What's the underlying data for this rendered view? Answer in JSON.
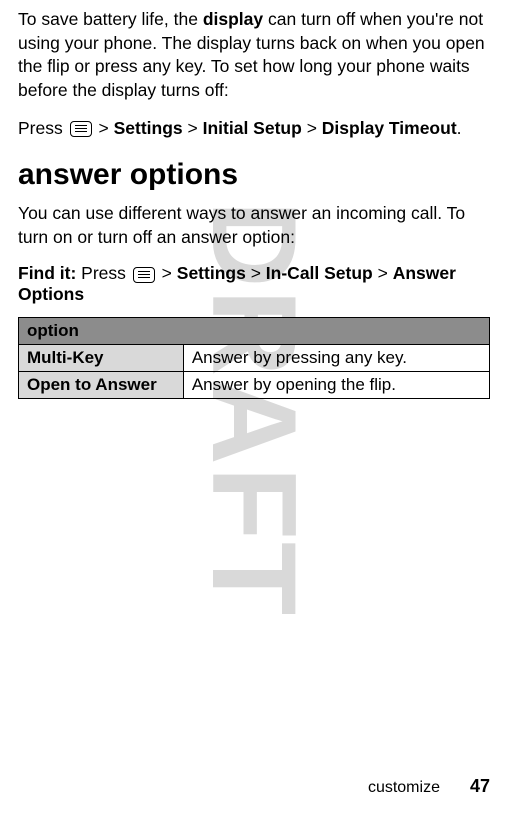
{
  "watermark": "DRAFT",
  "intro_part1": "To save battery life, the ",
  "intro_bold": "display",
  "intro_part2": " can turn off when you're not using your phone. The display turns back on when you open the flip or press any key. To set how long your phone waits before the display turns off:",
  "press_label": "Press ",
  "gt": ">",
  "path1_settings": "Settings",
  "path1_initial": "Initial Setup",
  "path1_display": "Display Timeout",
  "period": ".",
  "heading": "answer options",
  "para2": "You can use different ways to answer an incoming call. To turn on or turn off an answer option:",
  "find_it_label": "Find it:",
  "find_it_press": " Press ",
  "path2_settings": "Settings",
  "path2_incall": "In-Call Setup",
  "path2_answer": "Answer Options",
  "table_header": "option",
  "row1_opt": "Multi-Key",
  "row1_desc": "Answer by pressing any key.",
  "row2_opt": "Open to Answer",
  "row2_desc": "Answer by opening the flip.",
  "footer_section": "customize",
  "footer_page": "47"
}
